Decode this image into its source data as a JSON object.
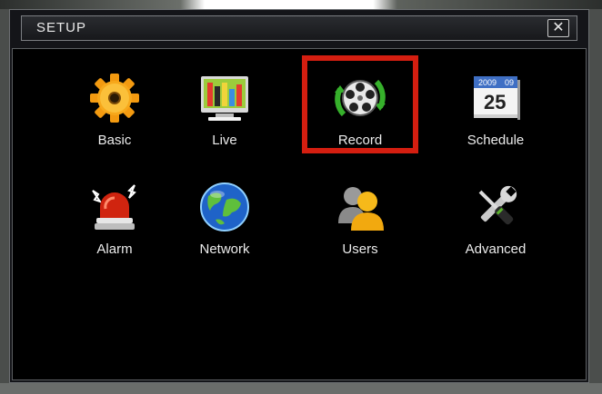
{
  "window": {
    "title": "SETUP",
    "close_symbol": "✕"
  },
  "menu": {
    "selected": "Record",
    "items": [
      {
        "label": "Basic",
        "icon": "gear-icon"
      },
      {
        "label": "Live",
        "icon": "monitor-icon"
      },
      {
        "label": "Record",
        "icon": "film-reel-icon"
      },
      {
        "label": "Schedule",
        "icon": "calendar-icon",
        "calendar_year": "2009",
        "calendar_month": "09",
        "calendar_day": "25"
      },
      {
        "label": "Alarm",
        "icon": "alarm-light-icon"
      },
      {
        "label": "Network",
        "icon": "globe-icon"
      },
      {
        "label": "Users",
        "icon": "users-icon"
      },
      {
        "label": "Advanced",
        "icon": "tools-icon"
      }
    ]
  },
  "colors": {
    "highlight": "#d41e10",
    "panel": "#000000",
    "text": "#ececec"
  }
}
